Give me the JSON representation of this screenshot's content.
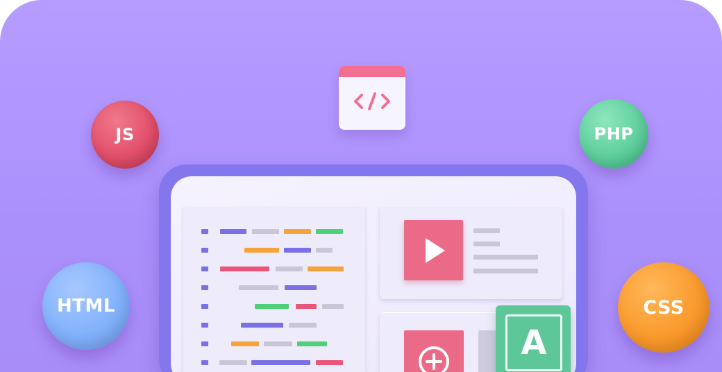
{
  "badges": {
    "js": "JS",
    "php": "PHP",
    "html": "HTML",
    "css": "CSS"
  },
  "font_tile": {
    "letter": "A"
  },
  "icons": {
    "code_window": "code-brackets-icon",
    "video": "play-icon",
    "add": "plus-circle-icon"
  },
  "colors": {
    "background": "#b69cff",
    "monitor_frame": "#8477ee",
    "js": "#e2506a",
    "php": "#5fcf9e",
    "html": "#83b2fb",
    "css": "#fa9a2d",
    "code_pink": "#f26f91",
    "accent_green": "#5ec79a"
  }
}
